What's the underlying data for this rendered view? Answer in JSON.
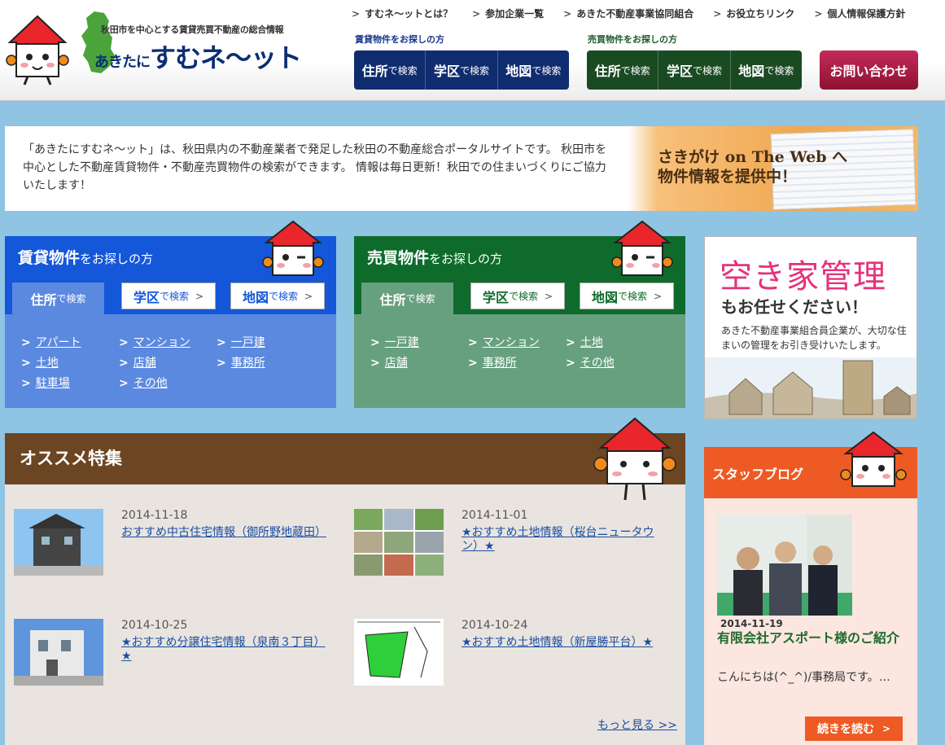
{
  "header": {
    "tagline": "秋田市を中心とする賃貸売買不動産の総合情報",
    "logo_small": "あきたに",
    "logo_big": "すむネ〜ット",
    "nav": [
      {
        "label": "すむネ〜ットとは？"
      },
      {
        "label": "参加企業一覧"
      },
      {
        "label": "あきた不動産事業協同組合"
      },
      {
        "label": "お役立ちリンク"
      },
      {
        "label": "個人情報保護方針"
      }
    ],
    "nav_chevron": ">",
    "rent_label": "賃貸物件をお探しの方",
    "sale_label": "売買物件をお探しの方",
    "rent_buttons": [
      {
        "big": "住所",
        "small": "で検索"
      },
      {
        "big": "学区",
        "small": "で検索"
      },
      {
        "big": "地図",
        "small": "で検索"
      }
    ],
    "sale_buttons": [
      {
        "big": "住所",
        "small": "で検索"
      },
      {
        "big": "学区",
        "small": "で検索"
      },
      {
        "big": "地図",
        "small": "で検索"
      }
    ],
    "contact": "お問い合わせ"
  },
  "intro": {
    "text": "「あきたにすむネ〜ット」は、秋田県内の不動産業者で発足した秋田の不動産総合ポータルサイトです。 秋田市を中心とした不動産賃貸物件・不動産売買物件の検索ができます。 情報は毎日更新！秋田での住まいづくりにご協力いたします！",
    "banner_line1": "さきがけ on The Web へ",
    "banner_line2": "物件情報を提供中！"
  },
  "rent_panel": {
    "title_bold": "賃貸物件",
    "title_rest": "をお探しの方",
    "tabs": [
      {
        "big": "住所",
        "small": "で検索"
      },
      {
        "big": "学区",
        "small": "で検索"
      },
      {
        "big": "地図",
        "small": "で検索"
      }
    ],
    "tab_arrow": ">",
    "link_chevron": ">",
    "links": [
      "アパート",
      "マンション",
      "一戸建",
      "土地",
      "店舗",
      "事務所",
      "駐車場",
      "その他"
    ]
  },
  "sale_panel": {
    "title_bold": "売買物件",
    "title_rest": "をお探しの方",
    "tabs": [
      {
        "big": "住所",
        "small": "で検索"
      },
      {
        "big": "学区",
        "small": "で検索"
      },
      {
        "big": "地図",
        "small": "で検索"
      }
    ],
    "tab_arrow": ">",
    "link_chevron": ">",
    "links": [
      "一戸建",
      "マンション",
      "土地",
      "店舗",
      "事務所",
      "その他"
    ]
  },
  "recommend": {
    "title": "オススメ特集",
    "items": [
      {
        "date": "2014-11-18",
        "title": "おすすめ中古住宅情報（御所野地蔵田）"
      },
      {
        "date": "2014-11-01",
        "title": "★おすすめ土地情報（桜台ニュータウン）★"
      },
      {
        "date": "2014-10-25",
        "title": "★おすすめ分譲住宅情報（泉南３丁目）★"
      },
      {
        "date": "2014-10-24",
        "title": "★おすすめ土地情報（新屋勝平台）★"
      }
    ],
    "more": "もっと見る >>"
  },
  "akiya": {
    "title": "空き家管理",
    "subtitle": "もお任せください！",
    "desc": "あきた不動産事業組合員企業が、大切な住まいの管理をお引き受けいたします。"
  },
  "blog": {
    "title": "スタッフブログ",
    "date": "2014-11-19",
    "post_title": "有限会社アスポート様のご紹介",
    "excerpt": "こんにちは(^_^)/事務局です。…",
    "more": "続きを読む",
    "more_chevron": ">"
  }
}
